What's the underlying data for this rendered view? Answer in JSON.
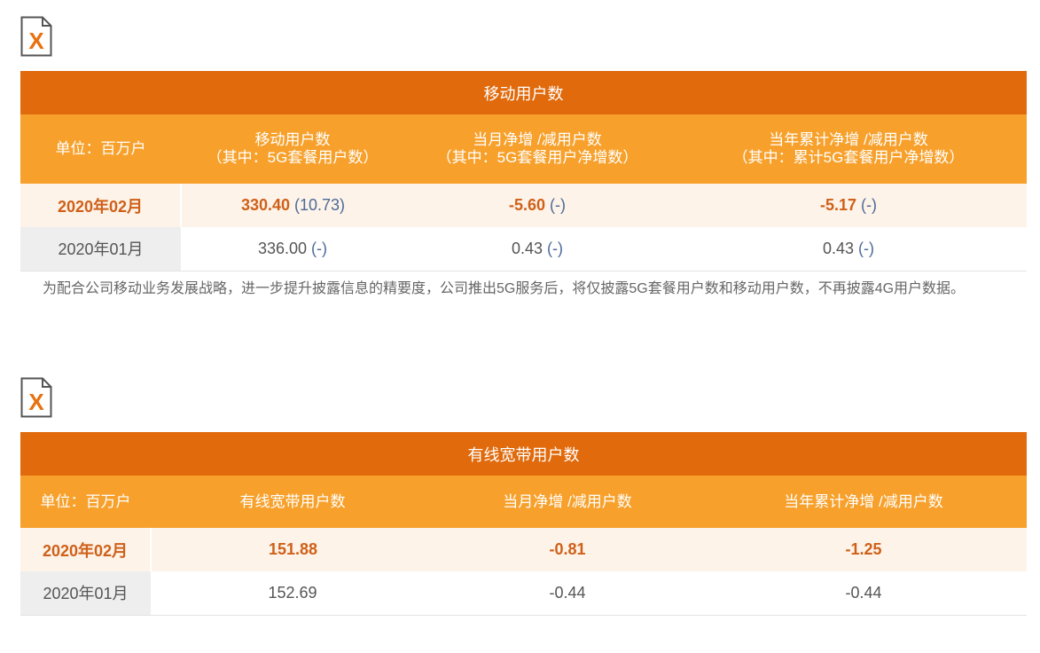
{
  "icon1": "excel-file-icon",
  "icon2": "excel-file-icon",
  "mobile": {
    "title": "移动用户数",
    "headers": {
      "unit": "单位：百万户",
      "c1_main": "移动用户数",
      "c1_sub": "（其中：5G套餐用户数）",
      "c2_main": "当月净增 /减用户数",
      "c2_sub": "（其中：5G套餐用户净增数）",
      "c3_main": "当年累计净增 /减用户数",
      "c3_sub": "（其中：累计5G套餐用户净增数）"
    },
    "rows": [
      {
        "period": "2020年02月",
        "c1": "330.40",
        "c1p": "(10.73)",
        "c2": "-5.60",
        "c2p": "(-)",
        "c3": "-5.17",
        "c3p": "(-)"
      },
      {
        "period": "2020年01月",
        "c1": "336.00",
        "c1p": "(-)",
        "c2": "0.43",
        "c2p": "(-)",
        "c3": "0.43",
        "c3p": "(-)"
      }
    ],
    "note": "为配合公司移动业务发展战略，进一步提升披露信息的精要度，公司推出5G服务后，将仅披露5G套餐用户数和移动用户数，不再披露4G用户数据。"
  },
  "broadband": {
    "title": "有线宽带用户数",
    "headers": {
      "unit": "单位：百万户",
      "c1": "有线宽带用户数",
      "c2": "当月净增 /减用户数",
      "c3": "当年累计净增 /减用户数"
    },
    "rows": [
      {
        "period": "2020年02月",
        "c1": "151.88",
        "c2": "-0.81",
        "c3": "-1.25"
      },
      {
        "period": "2020年01月",
        "c1": "152.69",
        "c2": "-0.44",
        "c3": "-0.44"
      }
    ]
  },
  "colors": {
    "title_bg": "#e06a0c",
    "header_bg": "#f7a12c",
    "highlight_text": "#cf6019",
    "paren_text": "#4d6a9a"
  }
}
